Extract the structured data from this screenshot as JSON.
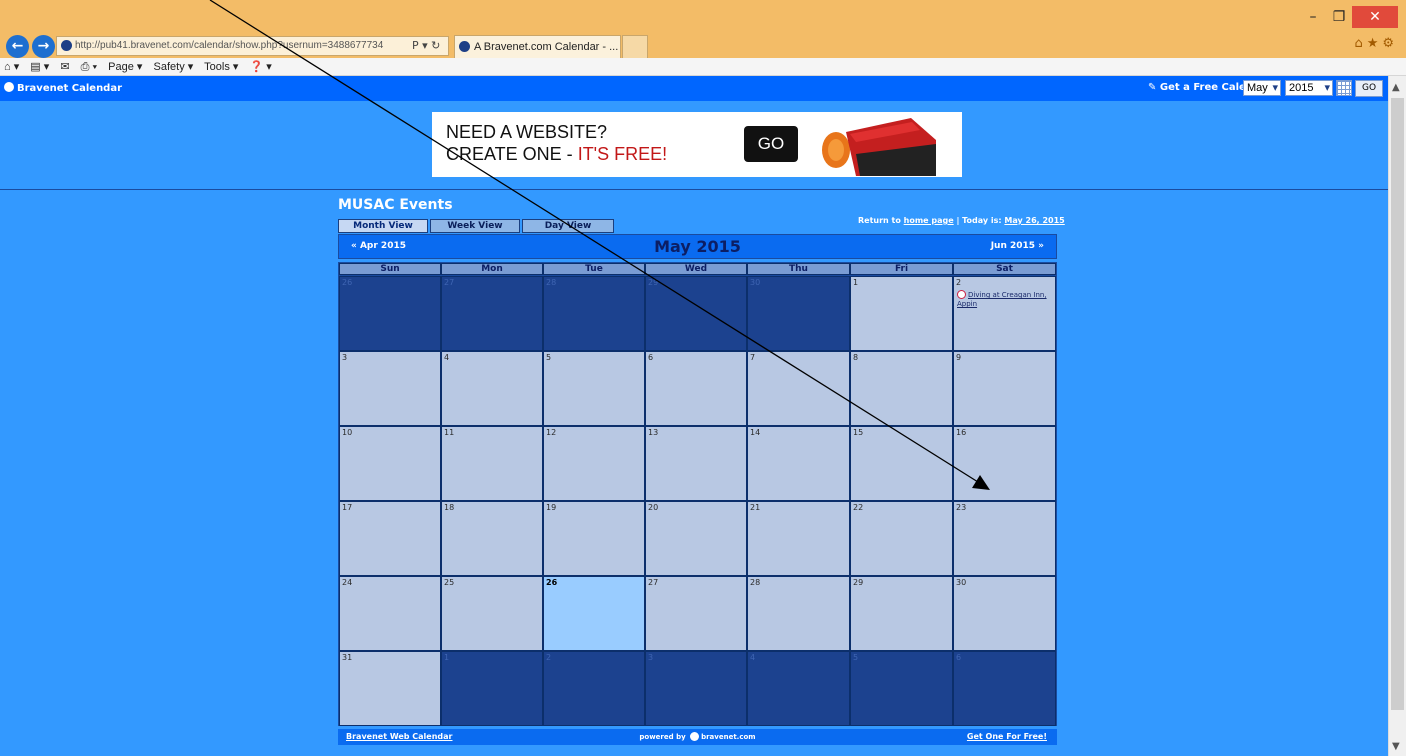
{
  "browser": {
    "address": "http://pub41.bravenet.com/calendar/show.php?usernum=3488677734",
    "address_host": "bravenet.com",
    "search_controls": "Ρ ▾ ↻",
    "tab_title": "A Bravenet.com Calendar - ... ×",
    "window_controls": {
      "minimize": "–",
      "maximize": "❐",
      "close": "✕"
    },
    "corner_icons": "⌂★⚙",
    "command_bar": [
      "⌂ ▾",
      "▤ ▾",
      "✉",
      "⎙ ▾",
      "Page ▾",
      "Safety ▾",
      "Tools ▾",
      "❓ ▾"
    ]
  },
  "topbar": {
    "brand": "Bravenet Calendar",
    "get_free": "Get a Free Calendar",
    "month_select": "May",
    "year_select": "2015",
    "go": "GO"
  },
  "ad": {
    "line1": "NEED A WEBSITE?",
    "line2_a": "CREATE ONE - ",
    "line2_b": "IT'S FREE!",
    "button": "GO"
  },
  "calendar": {
    "title": "MUSAC Events",
    "tabs": [
      "Month View",
      "Week View",
      "Day View"
    ],
    "return_prefix": "Return to ",
    "return_link": "home page",
    "today_prefix": " | Today is: ",
    "today_link": "May 26, 2015",
    "prev": "«  Apr 2015",
    "month_label": "May 2015",
    "next": "Jun 2015  »",
    "weekdays": [
      "Sun",
      "Mon",
      "Tue",
      "Wed",
      "Thu",
      "Fri",
      "Sat"
    ],
    "weeks": [
      [
        {
          "d": "26",
          "s": "out"
        },
        {
          "d": "27",
          "s": "out"
        },
        {
          "d": "28",
          "s": "out"
        },
        {
          "d": "29",
          "s": "out"
        },
        {
          "d": "30",
          "s": "out"
        },
        {
          "d": "1",
          "s": "cur"
        },
        {
          "d": "2",
          "s": "cur",
          "event": "Diving at Creagan Inn, Appin"
        }
      ],
      [
        {
          "d": "3",
          "s": "cur"
        },
        {
          "d": "4",
          "s": "cur"
        },
        {
          "d": "5",
          "s": "cur"
        },
        {
          "d": "6",
          "s": "cur"
        },
        {
          "d": "7",
          "s": "cur"
        },
        {
          "d": "8",
          "s": "cur"
        },
        {
          "d": "9",
          "s": "cur"
        }
      ],
      [
        {
          "d": "10",
          "s": "cur"
        },
        {
          "d": "11",
          "s": "cur"
        },
        {
          "d": "12",
          "s": "cur"
        },
        {
          "d": "13",
          "s": "cur"
        },
        {
          "d": "14",
          "s": "cur"
        },
        {
          "d": "15",
          "s": "cur"
        },
        {
          "d": "16",
          "s": "cur"
        }
      ],
      [
        {
          "d": "17",
          "s": "cur"
        },
        {
          "d": "18",
          "s": "cur"
        },
        {
          "d": "19",
          "s": "cur"
        },
        {
          "d": "20",
          "s": "cur"
        },
        {
          "d": "21",
          "s": "cur"
        },
        {
          "d": "22",
          "s": "cur"
        },
        {
          "d": "23",
          "s": "cur"
        }
      ],
      [
        {
          "d": "24",
          "s": "cur"
        },
        {
          "d": "25",
          "s": "cur"
        },
        {
          "d": "26",
          "s": "today"
        },
        {
          "d": "27",
          "s": "cur"
        },
        {
          "d": "28",
          "s": "cur"
        },
        {
          "d": "29",
          "s": "cur"
        },
        {
          "d": "30",
          "s": "cur"
        }
      ],
      [
        {
          "d": "31",
          "s": "cur"
        },
        {
          "d": "1",
          "s": "out"
        },
        {
          "d": "2",
          "s": "out"
        },
        {
          "d": "3",
          "s": "out"
        },
        {
          "d": "4",
          "s": "out"
        },
        {
          "d": "5",
          "s": "out"
        },
        {
          "d": "6",
          "s": "out"
        }
      ]
    ],
    "footer_left": "Bravenet Web Calendar",
    "footer_center_a": "powered by",
    "footer_center_b": "bravenet.com",
    "footer_right": "Get One For Free!"
  },
  "colors": {
    "page_bg": "#3399ff",
    "bar": "#0066ff",
    "cell_current": "#b8c8e3",
    "cell_outside": "#1c428f",
    "cell_today": "#99ccff"
  }
}
